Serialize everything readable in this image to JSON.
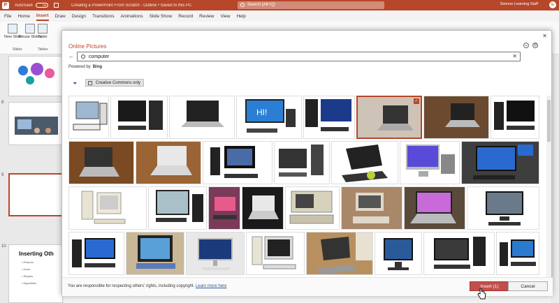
{
  "titlebar": {
    "autosave": "AutoSave",
    "toggle": "Off",
    "document": "Creating a PowerPoint From Scratch - Outline • Saved to this PC",
    "search_placeholder": "Search (Alt+Q)",
    "user": "Simone Learning Staff",
    "avatar": "SL"
  },
  "menu": [
    "File",
    "Home",
    "Insert",
    "Draw",
    "Design",
    "Transitions",
    "Animations",
    "Slide Show",
    "Record",
    "Review",
    "View",
    "Help"
  ],
  "ribbon": {
    "new_slide": "New Slide",
    "reuse_slides": "Reuse Slides",
    "table": "Table",
    "group_slides": "Slides",
    "group_tables": "Tables"
  },
  "slides": {
    "numbers": [
      "8",
      "9",
      "10"
    ],
    "slide10_heading": "Inserting Oth",
    "slide10_bullets": [
      "• Pictures",
      "• Icons",
      "• Shapes",
      "• Hyperlinks"
    ]
  },
  "dialog": {
    "title": "Online Pictures",
    "search_value": "computer",
    "powered_by": "Powered by",
    "bing": "Bing",
    "filter_label": "Creative Commons only",
    "footer_note": "You are responsible for respecting others' rights, including copyright.",
    "learn_more": "Learn more here",
    "insert_label": "Insert (1)",
    "cancel_label": "Cancel"
  },
  "colors": {
    "accent": "#b7472a",
    "insert_button": "#c0504d",
    "link": "#2b5797"
  },
  "icons": [
    "search-icon",
    "close-icon",
    "back-arrow-icon",
    "filter-icon",
    "checkbox-icon",
    "smiley-icon",
    "frown-icon",
    "hand-cursor-icon"
  ]
}
